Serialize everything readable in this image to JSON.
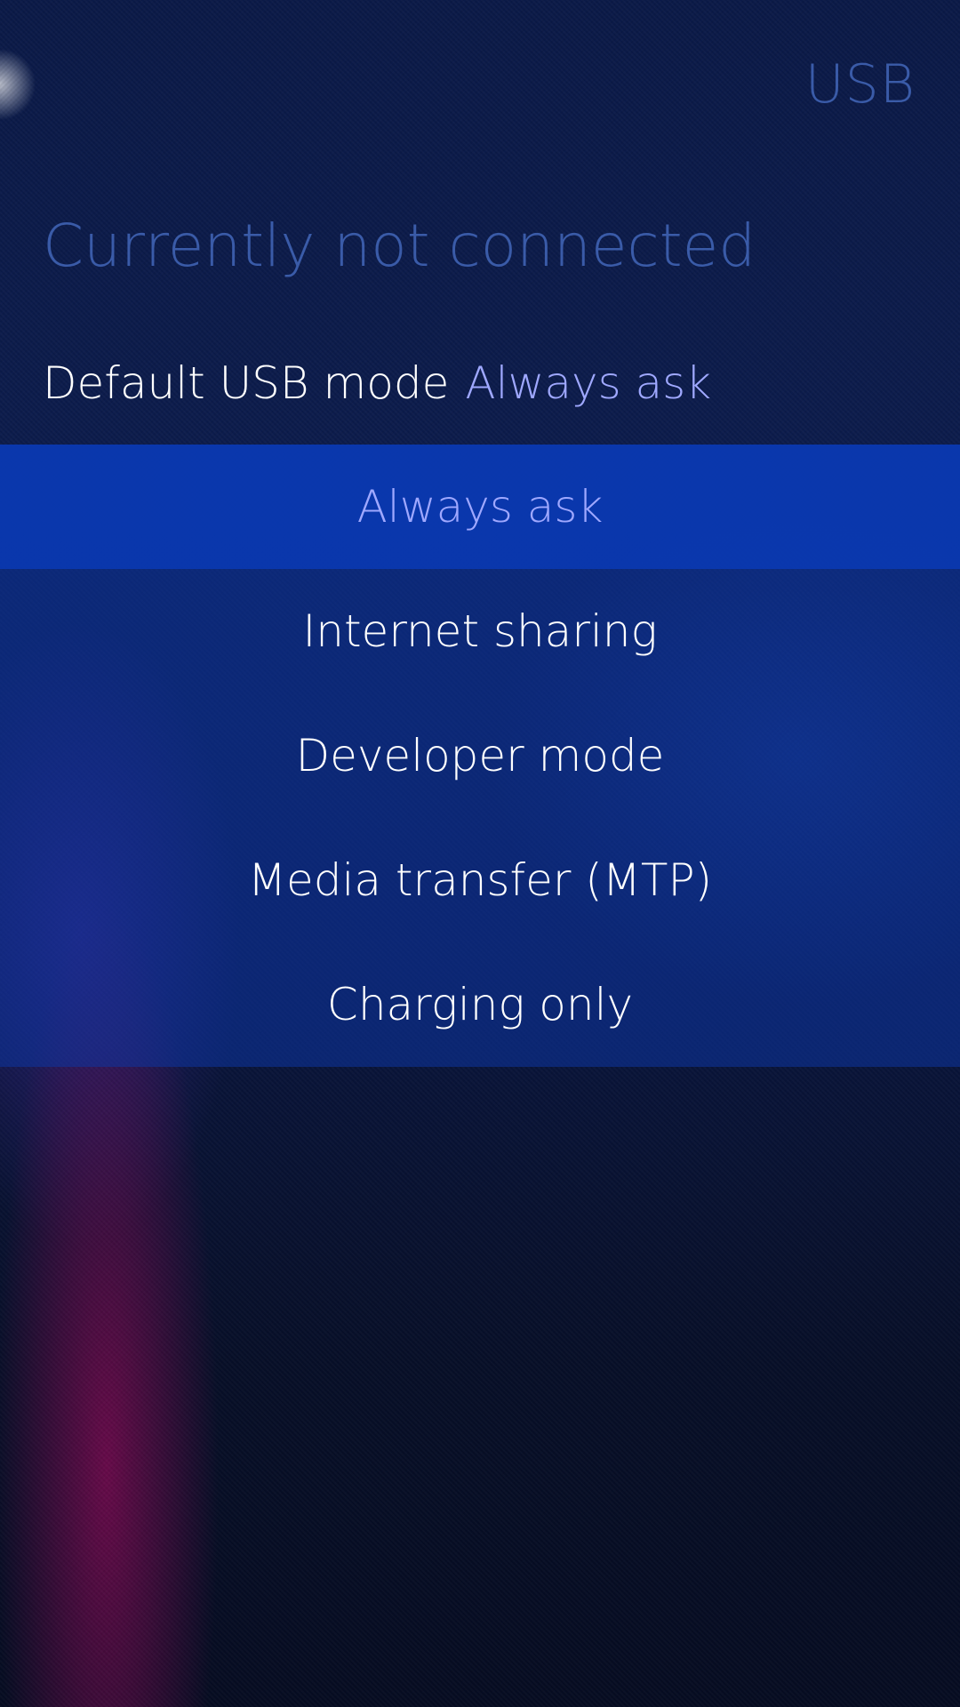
{
  "page": {
    "title": "USB"
  },
  "section": {
    "header": "Currently not connected"
  },
  "combo": {
    "label": "Default USB mode",
    "value": "Always ask"
  },
  "menu": {
    "selected_index": 0,
    "items": [
      {
        "label": "Always ask"
      },
      {
        "label": "Internet sharing"
      },
      {
        "label": "Developer mode"
      },
      {
        "label": "Media transfer (MTP)"
      },
      {
        "label": "Charging only"
      }
    ]
  },
  "colors": {
    "highlight_text": "#9fa8ff",
    "header_text": "#3a5ba8",
    "menu_background": "#0c34a0",
    "selected_background": "#0a3cbe"
  }
}
